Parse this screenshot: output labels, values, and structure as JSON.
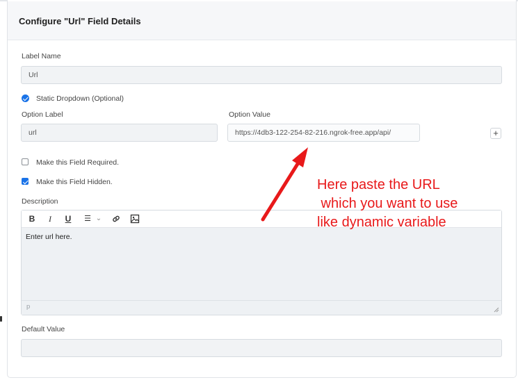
{
  "dialog": {
    "title": "Configure \"Url\" Field Details"
  },
  "label_name": {
    "label": "Label Name",
    "value": "Url"
  },
  "static_dropdown": {
    "label": "Static Dropdown (Optional)",
    "checked": true
  },
  "option_label": {
    "label": "Option Label",
    "value": "url"
  },
  "option_value": {
    "label": "Option Value",
    "value": "https://4db3-122-254-82-216.ngrok-free.app/api/"
  },
  "add_option": {
    "label": "+"
  },
  "required": {
    "label": "Make this Field Required.",
    "checked": false
  },
  "hidden": {
    "label": "Make this Field Hidden.",
    "checked": true
  },
  "description": {
    "label": "Description",
    "content": "Enter url here.",
    "status_path": "p",
    "toolbar": {
      "bold": "B",
      "italic": "I",
      "underline": "U",
      "list": "☰",
      "dropdown": "⌄"
    }
  },
  "default_value": {
    "label": "Default Value",
    "value": ""
  },
  "annotation": {
    "text": "Here paste the URL\n which you want to use\nlike dynamic variable",
    "color": "#e8191a"
  },
  "colors": {
    "accent": "#1a73e8",
    "annotation": "#e8191a"
  }
}
